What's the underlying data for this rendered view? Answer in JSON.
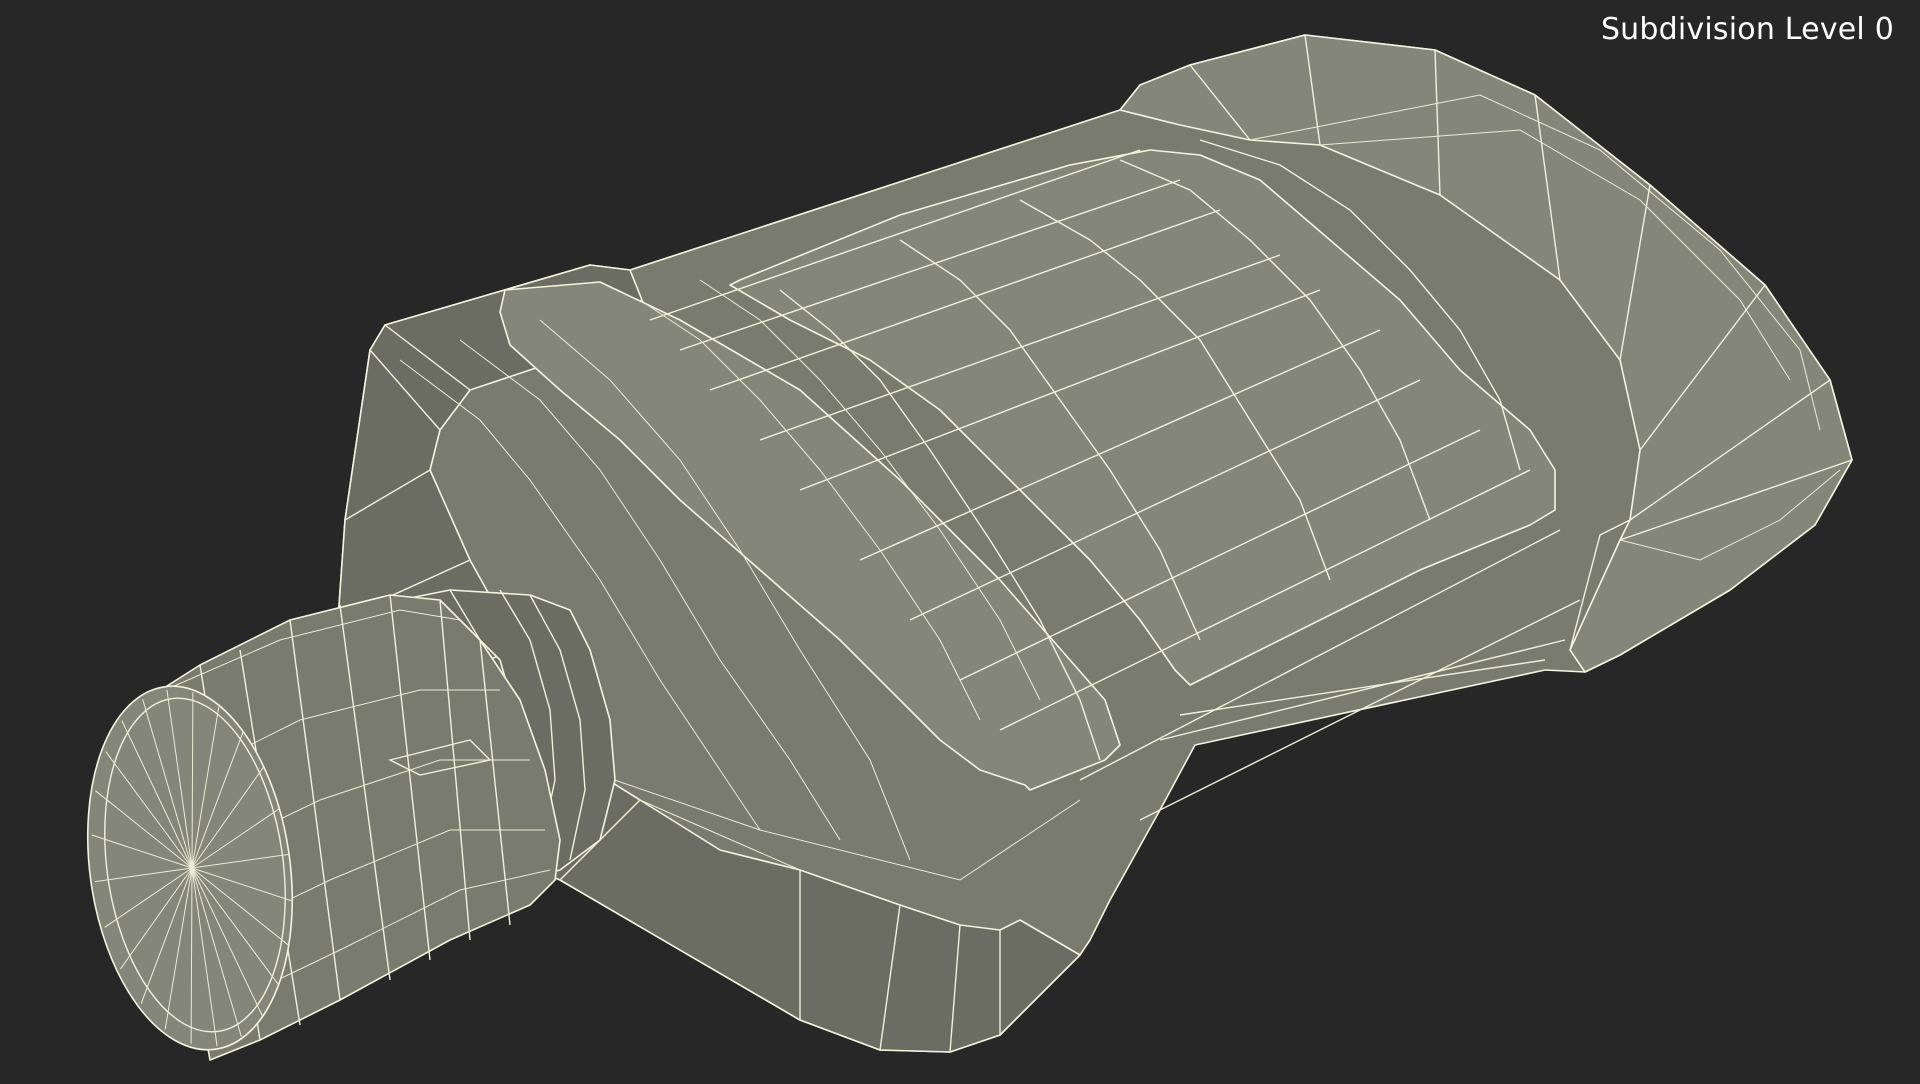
{
  "viewport": {
    "label": "Subdivision Level 0",
    "background_color": "#272727",
    "mesh_color": "#7a7b6f",
    "wire_color": "#f4f3df"
  }
}
